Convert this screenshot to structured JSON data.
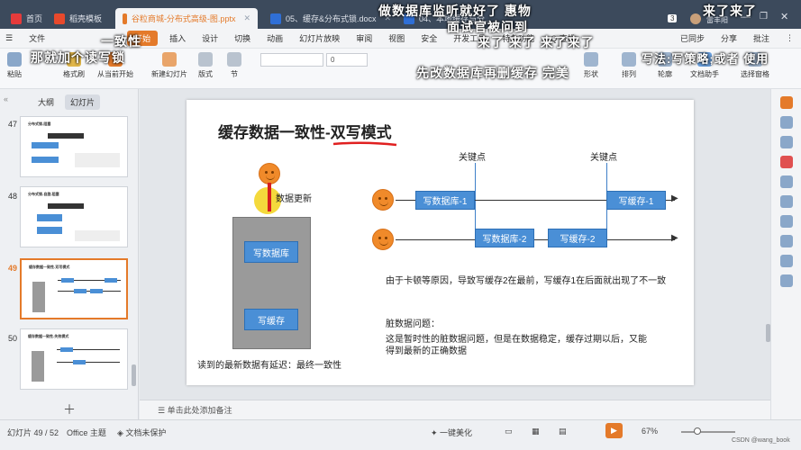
{
  "titlebar": {
    "tabs": [
      {
        "label": "首页",
        "color": "#e53b3b"
      },
      {
        "label": "稻壳模板",
        "color": "#e8492c"
      },
      {
        "label": "谷粒商城-分布式高级-图.pptx",
        "color": "#e47a2a"
      },
      {
        "label": "05、缓存&分布式锁.docx",
        "color": "#2f6fd6"
      },
      {
        "label": "04、本地缓存与分...",
        "color": "#2f6fd6"
      }
    ],
    "badge": "3",
    "user": "雷丰阳"
  },
  "menubar": {
    "file": "文件",
    "items": [
      "开始",
      "插入",
      "设计",
      "切换",
      "动画",
      "幻灯片放映",
      "审阅",
      "视图",
      "安全",
      "开发工具",
      "特色功能",
      "Q 查找"
    ],
    "right": [
      "已同步",
      "分享",
      "批注"
    ]
  },
  "ribbon": {
    "buttons": [
      "粘贴",
      "格式刷",
      "从当前开始",
      "新建幻灯片",
      "版式",
      "节",
      "重置",
      "形状",
      "排列",
      "轮廓",
      "文档助手",
      "选择窗格"
    ],
    "font_size": "0",
    "font_name": ""
  },
  "overlays": [
    "做数据库监听就好了 惠物",
    "来了来了",
    "一致性",
    "那就加个读写锁",
    "面试官被问到",
    "来了 来了 来了来了",
    "先改数据库再删缓存 完美",
    "写法:写策略;或者 使用"
  ],
  "panel": {
    "tabs": [
      "大纲",
      "幻灯片"
    ],
    "slides": [
      {
        "num": "47",
        "title": "分布式锁-阻塞"
      },
      {
        "num": "48",
        "title": "分布式锁-自旋-阻塞"
      },
      {
        "num": "49",
        "title": "缓存数据一致性-双写模式"
      },
      {
        "num": "50",
        "title": "缓存数据一致性-失效模式"
      }
    ]
  },
  "slide": {
    "title_part1": "缓存数据一致性-",
    "title_part2": "双写模式",
    "data_update": "数据更新",
    "write_db": "写数据库",
    "write_cache": "写缓存",
    "bottom_note": "读到的最新数据有延迟：最终一致性",
    "key_point_1": "关键点",
    "key_point_2": "关键点",
    "row1_db": "写数据库-1",
    "row1_cache": "写缓存-1",
    "row2_db": "写数据库-2",
    "row2_cache": "写缓存-2",
    "reason": "由于卡顿等原因，导致写缓存2在最前，写缓存1在后面就出现了不一致",
    "dirty_title": "脏数据问题：",
    "dirty_line1": "这是暂时性的脏数据问题，但是在数据稳定，缓存过期以后，又能",
    "dirty_line2": "得到最新的正确数据"
  },
  "notes": {
    "placeholder": "单击此处添加备注"
  },
  "status": {
    "slide_info": "幻灯片 49 / 52",
    "theme": "Office 主题",
    "protect": "文档未保护",
    "beautify": "一键美化",
    "zoom": "67%",
    "watermark": "CSDN @wang_book"
  },
  "colors": {
    "accent": "#e47a2a",
    "blue_box": "#4a8fd6",
    "face": "#f08a2a",
    "title_bar": "#3c4a5c"
  }
}
